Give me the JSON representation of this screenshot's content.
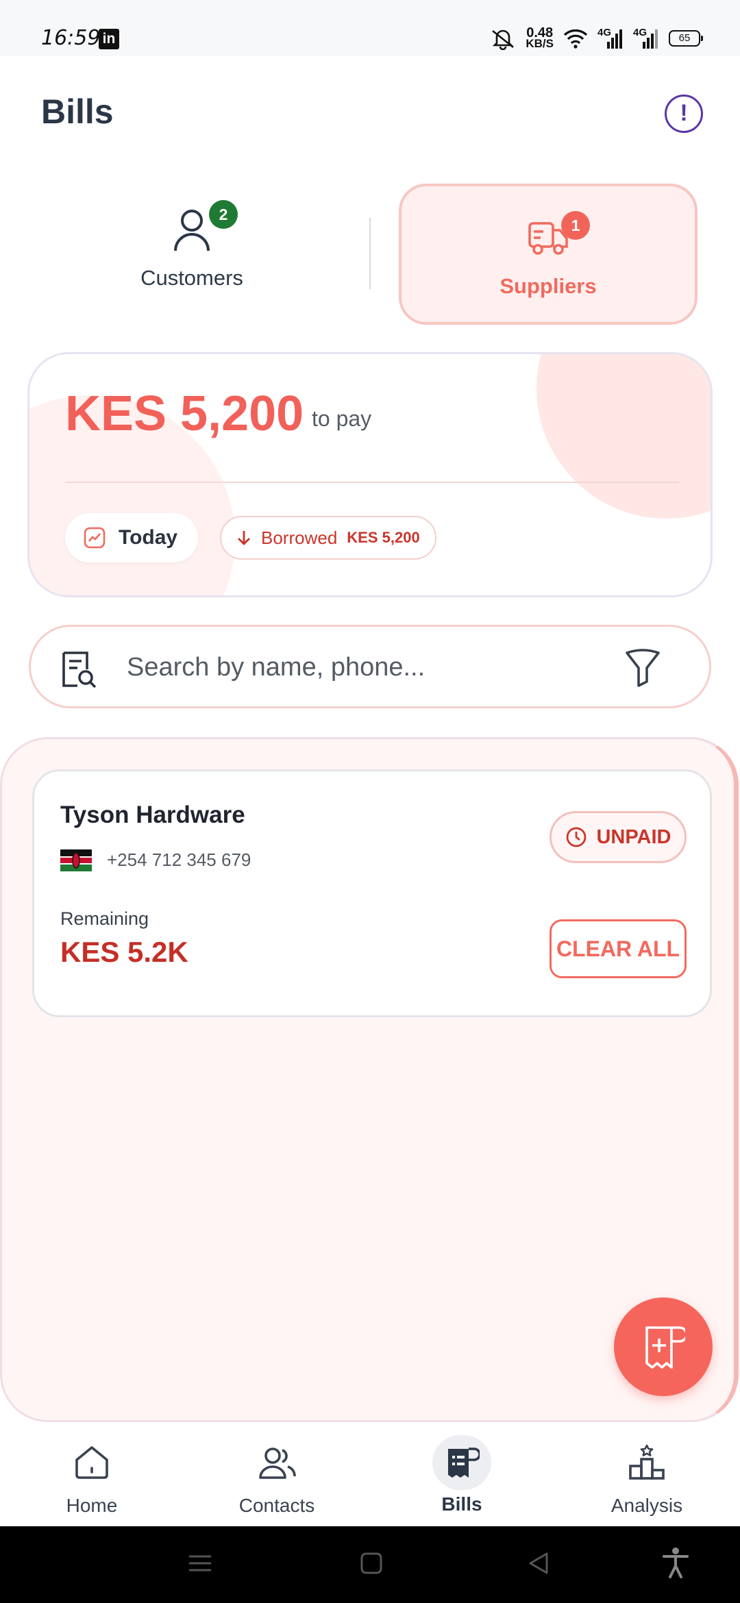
{
  "status_bar": {
    "time": "16:59",
    "app_icon": "linkedin-icon",
    "app_icon_text": "in",
    "speed_value": "0.48",
    "speed_unit": "KB/S",
    "net1": "4G",
    "net2": "4G",
    "battery": "65"
  },
  "header": {
    "title": "Bills",
    "info_label": "!"
  },
  "toggle": {
    "customers": {
      "label": "Customers",
      "badge": "2"
    },
    "suppliers": {
      "label": "Suppliers",
      "badge": "1"
    }
  },
  "summary": {
    "amount": "KES 5,200",
    "suffix": "to pay",
    "period_chip": "Today",
    "borrowed_label": "Borrowed",
    "borrowed_value": "KES 5,200"
  },
  "search": {
    "placeholder": "Search by name, phone..."
  },
  "bills": [
    {
      "name": "Tyson Hardware",
      "phone": "+254 712 345 679",
      "status": "UNPAID",
      "remaining_label": "Remaining",
      "remaining_value": "KES 5.2K",
      "action": "CLEAR ALL"
    }
  ],
  "bottom_nav": [
    {
      "label": "Home",
      "icon": "home-icon"
    },
    {
      "label": "Contacts",
      "icon": "contacts-icon"
    },
    {
      "label": "Bills",
      "icon": "bills-icon",
      "active": true
    },
    {
      "label": "Analysis",
      "icon": "analysis-icon"
    }
  ],
  "colors": {
    "accent": "#f16a5e",
    "unpaid": "#c9352b",
    "title": "#2b3647",
    "info": "#5b35a6",
    "badge_green": "#1f7a34"
  }
}
